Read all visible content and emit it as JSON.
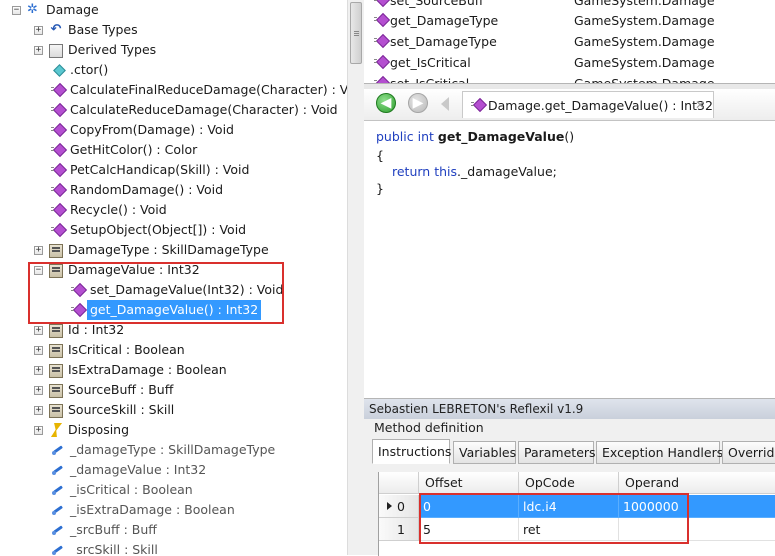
{
  "tree": {
    "root": "Damage",
    "items": [
      {
        "label": "Base Types"
      },
      {
        "label": "Derived Types"
      },
      {
        "label": ".ctor()"
      },
      {
        "label": "CalculateFinalReduceDamage(Character) : Void"
      },
      {
        "label": "CalculateReduceDamage(Character) : Void"
      },
      {
        "label": "CopyFrom(Damage) : Void"
      },
      {
        "label": "GetHitColor() : Color"
      },
      {
        "label": "PetCalcHandicap(Skill) : Void"
      },
      {
        "label": "RandomDamage() : Void"
      },
      {
        "label": "Recycle() : Void"
      },
      {
        "label": "SetupObject(Object[]) : Void"
      },
      {
        "label": "DamageType : SkillDamageType"
      },
      {
        "label": "DamageValue : Int32"
      },
      {
        "label": "set_DamageValue(Int32) : Void"
      },
      {
        "label": "get_DamageValue() : Int32"
      },
      {
        "label": "Id : Int32"
      },
      {
        "label": "IsCritical : Boolean"
      },
      {
        "label": "IsExtraDamage : Boolean"
      },
      {
        "label": "SourceBuff : Buff"
      },
      {
        "label": "SourceSkill : Skill"
      },
      {
        "label": "Disposing"
      },
      {
        "label": "_damageType : SkillDamageType"
      },
      {
        "label": "_damageValue : Int32"
      },
      {
        "label": "_isCritical : Boolean"
      },
      {
        "label": "_isExtraDamage : Boolean"
      },
      {
        "label": "_srcBuff : Buff"
      },
      {
        "label": "_srcSkill : Skill"
      }
    ],
    "expand_plus": "+",
    "expand_minus": "−"
  },
  "members": [
    {
      "name": "set_SourceBuff",
      "decl": "GameSystem.Damage"
    },
    {
      "name": "get_DamageType",
      "decl": "GameSystem.Damage"
    },
    {
      "name": "set_DamageType",
      "decl": "GameSystem.Damage"
    },
    {
      "name": "get_IsCritical",
      "decl": "GameSystem.Damage"
    },
    {
      "name": "set_IsCritical",
      "decl": "GameSystem.Damage"
    }
  ],
  "nav": {
    "back_glyph": "◀",
    "forward_glyph": "▶",
    "tab_title": "Damage.get_DamageValue() : Int32",
    "tab_close": "✕"
  },
  "code": {
    "kw_public": "public",
    "kw_int": "int",
    "method_name": "get_DamageValue",
    "parens": "()",
    "open_brace": "{",
    "kw_return": "return",
    "kw_this": "this",
    "field_expr": "._damageValue;",
    "close_brace": "}"
  },
  "reflexil": {
    "title": "Sebastien LEBRETON's Reflexil v1.9",
    "subtitle": "Method definition",
    "tabs": [
      "Instructions",
      "Variables",
      "Parameters",
      "Exception Handlers",
      "Override"
    ],
    "columns": [
      "Offset",
      "OpCode",
      "Operand"
    ],
    "rows": [
      {
        "index": "0",
        "offset": "0",
        "opcode": "ldc.i4",
        "operand": "1000000"
      },
      {
        "index": "1",
        "offset": "5",
        "opcode": "ret",
        "operand": ""
      }
    ]
  },
  "colors": {
    "selection": "#3399ff",
    "highlight_box": "#d9302d",
    "keyword": "#1f3fbf"
  }
}
